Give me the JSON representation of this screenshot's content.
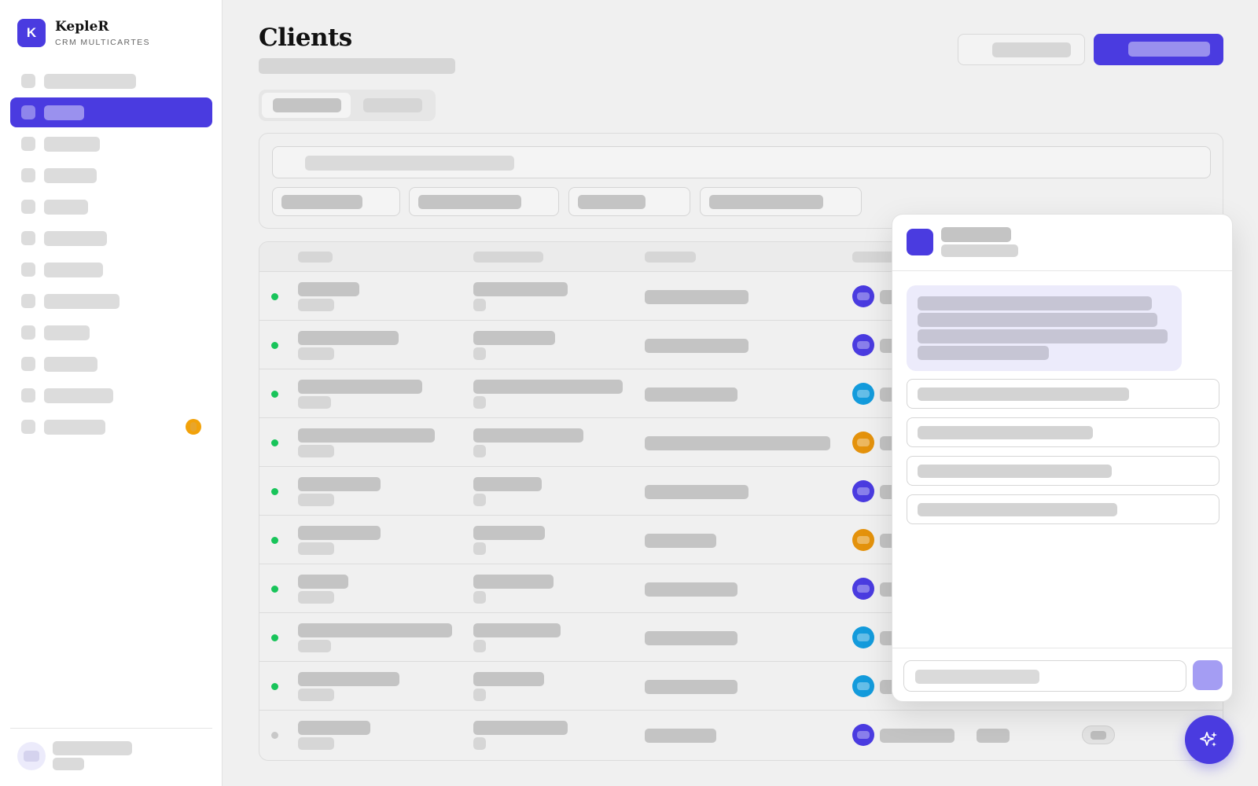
{
  "brand": {
    "logo_letter": "K",
    "name": "KepleR",
    "subtitle": "CRM MULTICARTES"
  },
  "page": {
    "title": "Clients"
  },
  "colors": {
    "accent": "#4a3be0",
    "status_online": "#18c45a",
    "status_offline": "#c8c8c8",
    "badge": "#f2a20a",
    "avatar_indigo": "#4a3be0",
    "avatar_sky": "#139bdc",
    "avatar_amber": "#e4920c"
  },
  "sidebar": {
    "items": [
      {
        "active": false,
        "badge": false
      },
      {
        "active": true,
        "badge": false
      },
      {
        "active": false,
        "badge": false
      },
      {
        "active": false,
        "badge": false
      },
      {
        "active": false,
        "badge": false
      },
      {
        "active": false,
        "badge": false
      },
      {
        "active": false,
        "badge": false
      },
      {
        "active": false,
        "badge": false
      },
      {
        "active": false,
        "badge": false
      },
      {
        "active": false,
        "badge": false
      },
      {
        "active": false,
        "badge": false
      },
      {
        "active": false,
        "badge": true
      }
    ]
  },
  "table": {
    "rows": [
      {
        "status": "online",
        "avatar_color": "indigo"
      },
      {
        "status": "online",
        "avatar_color": "indigo"
      },
      {
        "status": "online",
        "avatar_color": "sky"
      },
      {
        "status": "online",
        "avatar_color": "amber"
      },
      {
        "status": "online",
        "avatar_color": "indigo"
      },
      {
        "status": "online",
        "avatar_color": "amber"
      },
      {
        "status": "online",
        "avatar_color": "indigo"
      },
      {
        "status": "online",
        "avatar_color": "sky"
      },
      {
        "status": "online",
        "avatar_color": "sky"
      },
      {
        "status": "offline",
        "avatar_color": "indigo"
      }
    ]
  },
  "icons": {
    "fab": "sparkle-icon",
    "assistant": "bot-icon",
    "send": "send-icon"
  }
}
